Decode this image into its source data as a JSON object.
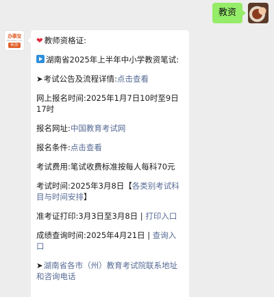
{
  "outgoing": {
    "text": "教资"
  },
  "sender": {
    "logo_brand": "办事宝",
    "logo_sub": "banshibao.com",
    "logo_city": "长沙"
  },
  "message": {
    "header": "教师资格证:",
    "exam_title": "湖南省2025年上半年中小学教资笔试:",
    "notice_label": "考试公告及流程详情:",
    "notice_link": "点击查看",
    "reg_time_label": "网上报名时间:",
    "reg_time_value": "2025年1月7日10时至9日17时",
    "reg_site_label": "报名网址:",
    "reg_site_link": "中国教育考试网",
    "conditions_label": "报名条件:",
    "conditions_link": "点击查看",
    "fee_label": "考试费用:",
    "fee_value": "笔试收费标准按每人每科70元",
    "exam_time_label": "考试时间:",
    "exam_time_value": "2025年3月8日",
    "exam_time_bracket_open": "【",
    "exam_time_link": "各类别考试科目与时间安排",
    "exam_time_bracket_close": "】",
    "admit_label": "准考证打印:",
    "admit_value": "3月3日至3月8日 | ",
    "admit_link": "打印入口",
    "score_label": "成绩查询时间:",
    "score_value": "2025年4月21日 | ",
    "score_link": "查询入口",
    "contact_link": "湖南省各市（州）教育考试院联系地址和咨询电话"
  },
  "colors": {
    "link": "#576b95",
    "outgoing_bubble": "#95ec69",
    "background": "#ededed"
  },
  "icons": [
    "heart-icon",
    "play-icon",
    "arrow-icon"
  ]
}
